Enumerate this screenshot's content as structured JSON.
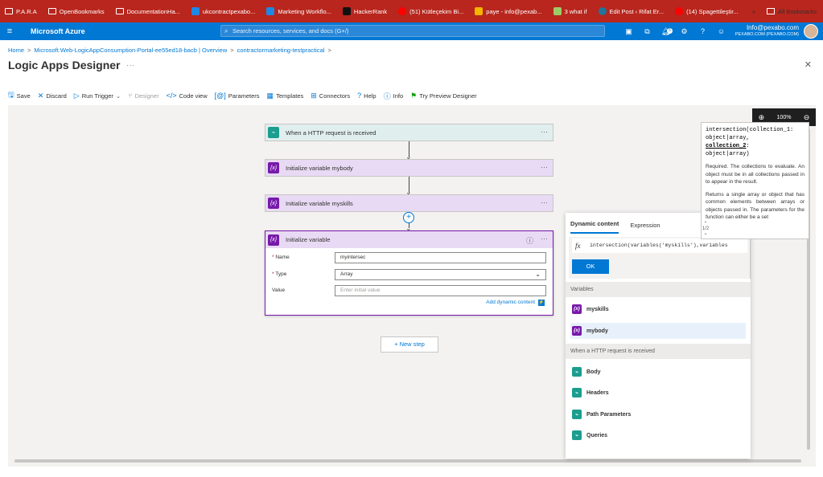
{
  "bookmarks": {
    "items": [
      "P.A.R.A",
      "OpenBookmarks",
      "DocumentationHa...",
      "ukcontractpexabo...",
      "Marketing Workflo...",
      "HackerRank",
      "(51) Kütleçekim Bi...",
      "paye - info@pexab...",
      "3 what if",
      "Edit Post ‹ Rifat Er...",
      "(14) Spagettileştir..."
    ],
    "overflow": "»",
    "all_bookmarks": "All Bookmarks"
  },
  "azure": {
    "hamburger": "≡",
    "brand": "Microsoft Azure",
    "search_placeholder": "Search resources, services, and docs (G+/)",
    "notification_count": "5",
    "account_email": "Info@pexabo.com",
    "account_org": "PEXABO.COM (PEXABO.COM)"
  },
  "breadcrumb": {
    "home": "Home",
    "resource": "Microsoft.Web-LogicAppConsumption-Portal-ee55ed18-bacb | Overview",
    "app": "contractormarketing-testpractical",
    "sep": ">"
  },
  "page": {
    "title": "Logic Apps Designer",
    "more": "···",
    "close": "✕"
  },
  "toolbar": {
    "save": "Save",
    "discard": "Discard",
    "run_trigger": "Run Trigger",
    "designer": "Designer",
    "code_view": "Code view",
    "parameters": "Parameters",
    "templates": "Templates",
    "connectors": "Connectors",
    "help": "Help",
    "info": "Info",
    "try_preview": "Try Preview Designer"
  },
  "zoom": {
    "level": "100%"
  },
  "steps": {
    "trigger": "When a HTTP request is received",
    "init_mybody": "Initialize variable mybody",
    "init_myskills": "Initialize variable myskills",
    "init_active": "Initialize variable",
    "more": "···"
  },
  "active_step": {
    "name_label": "Name",
    "name_value": "myintersec",
    "type_label": "Type",
    "type_value": "Array",
    "value_label": "Value",
    "value_placeholder": "Enter initial value",
    "add_dynamic": "Add dynamic content"
  },
  "new_step": "+ New step",
  "dynamic_panel": {
    "tab_dynamic": "Dynamic content",
    "tab_expression": "Expression",
    "expression_value": "intersection(variables('myskills'),variables",
    "ok": "OK",
    "section_variables": "Variables",
    "var_items": [
      "myskills",
      "mybody"
    ],
    "section_http": "When a HTTP request is received",
    "http_items": [
      "Body",
      "Headers",
      "Path Parameters",
      "Queries"
    ]
  },
  "tooltip": {
    "sig_line1": "intersection(collection_1:",
    "sig_line2": "object|array,",
    "sig_param": "collection_2",
    "sig_line3_suffix": ":",
    "sig_line4": "object|array)",
    "desc1": "Required. The collections to evaluate. An object must be in all collections passed in to appear in the result.",
    "desc2": "Returns a single array or object that has common elements between arrays or objects passed in. The parameters for the function can either be a set",
    "counter": "1/2"
  }
}
